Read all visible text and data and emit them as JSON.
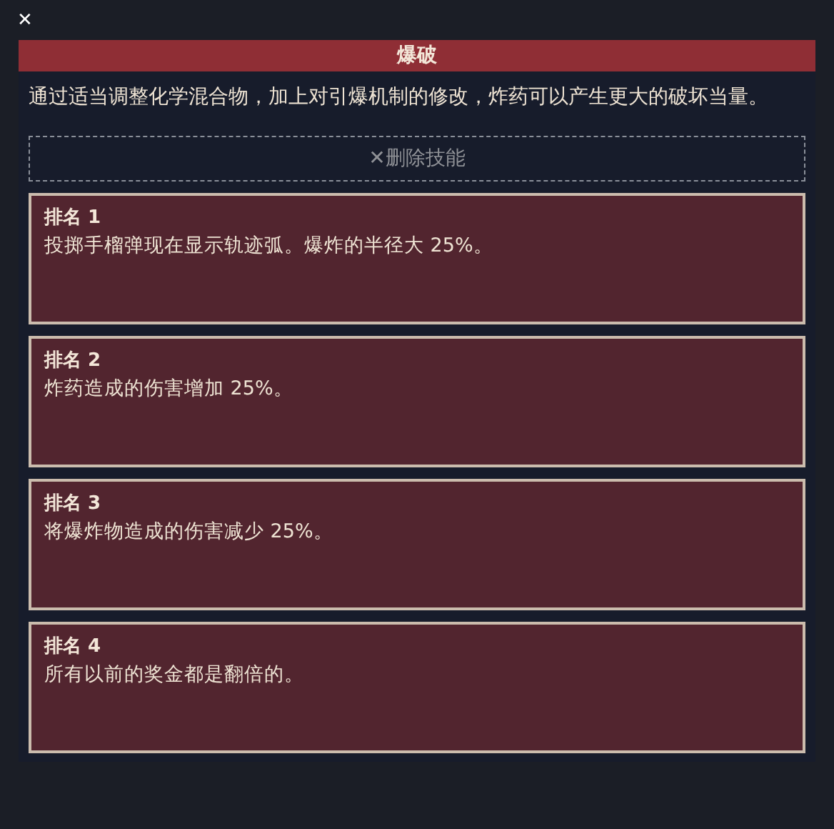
{
  "close_button": "✕",
  "panel": {
    "title": "爆破",
    "description": "通过适当调整化学混合物，加上对引爆机制的修改，炸药可以产生更大的破坏当量。",
    "remove_button": "✕删除技能",
    "ranks": [
      {
        "title": "排名 1",
        "text": "投掷手榴弹现在显示轨迹弧。爆炸的半径大 25%。"
      },
      {
        "title": "排名 2",
        "text": "炸药造成的伤害增加 25%。"
      },
      {
        "title": "排名 3",
        "text": "将爆炸物造成的伤害减少 25%。"
      },
      {
        "title": "排名 4",
        "text": "所有以前的奖金都是翻倍的。"
      }
    ]
  }
}
